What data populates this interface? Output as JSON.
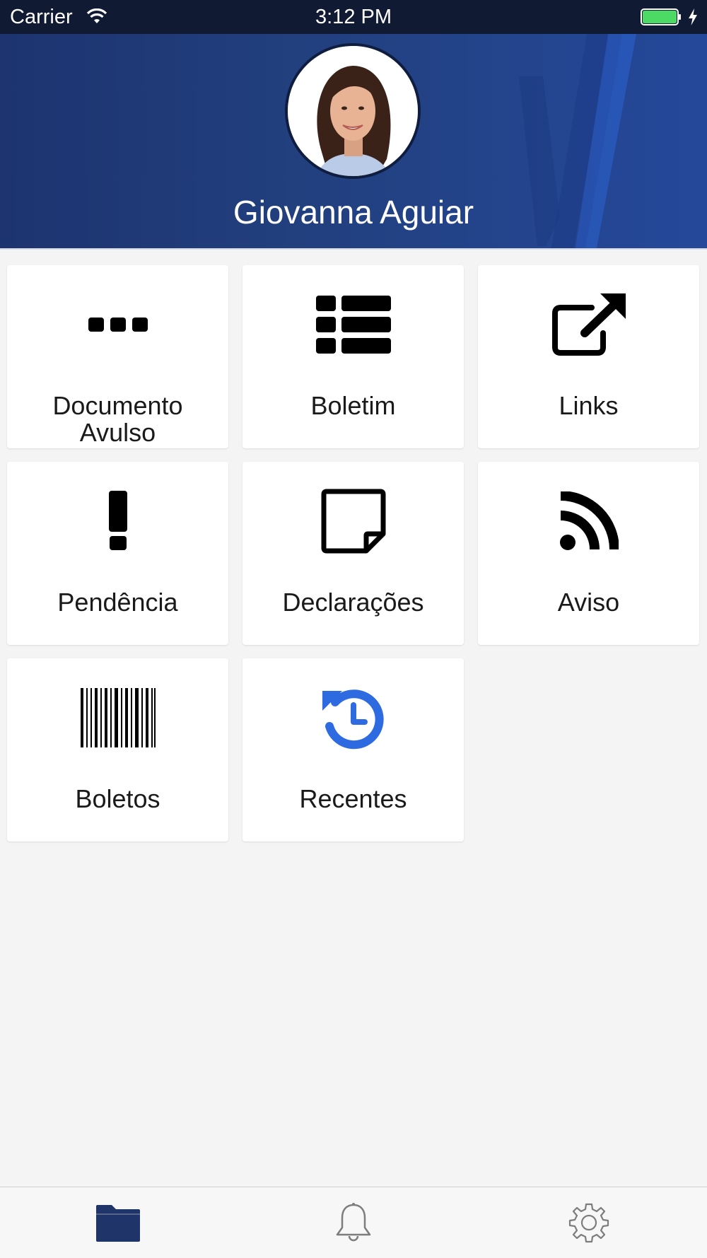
{
  "status_bar": {
    "carrier": "Carrier",
    "time": "3:12 PM",
    "icons": [
      "wifi-icon",
      "battery-icon",
      "charging-bolt-icon"
    ],
    "battery_color": "#4cd964"
  },
  "profile": {
    "name": "Giovanna Aguiar",
    "avatar": "avatar"
  },
  "grid": {
    "items": [
      {
        "label_line1": "Documento",
        "label_line2": "Avulso",
        "icon": "ellipsis-icon"
      },
      {
        "label": "Boletim",
        "icon": "list-icon"
      },
      {
        "label": "Links",
        "icon": "external-link-icon"
      },
      {
        "label": "Pendência",
        "icon": "exclamation-icon"
      },
      {
        "label": "Declarações",
        "icon": "sticky-note-icon"
      },
      {
        "label": "Aviso",
        "icon": "rss-icon"
      },
      {
        "label": "Boletos",
        "icon": "barcode-icon"
      },
      {
        "label": "Recentes",
        "icon": "history-icon"
      }
    ]
  },
  "tab_bar": {
    "tabs": [
      {
        "name": "folder",
        "icon": "folder-icon",
        "active": true
      },
      {
        "name": "notifications",
        "icon": "bell-icon",
        "active": false
      },
      {
        "name": "settings",
        "icon": "gear-icon",
        "active": false
      }
    ]
  },
  "colors": {
    "header_bg": "#22407f",
    "status_bar_bg": "#101a33",
    "accent_blue": "#2f6be0",
    "active_tab": "#1f3468",
    "tile_bg": "#ffffff",
    "page_bg": "#f4f4f4"
  }
}
